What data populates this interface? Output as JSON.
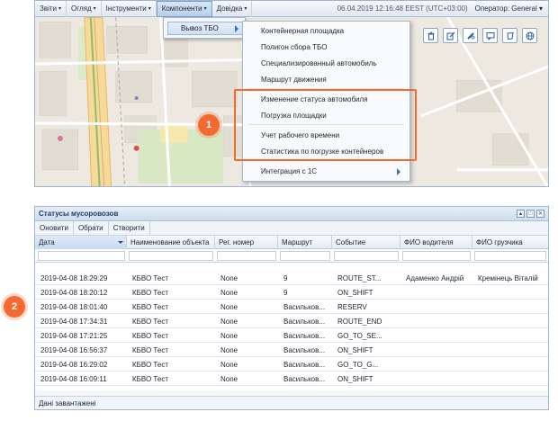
{
  "menubar": {
    "items": [
      {
        "label": "Звіти"
      },
      {
        "label": "Огляд"
      },
      {
        "label": "Інструменти"
      },
      {
        "label": "Компоненти"
      },
      {
        "label": "Довідка"
      }
    ],
    "datetime": "06.04.2019 12:16:48 EEST (UTC+03:00)",
    "operator": "Оператор: General"
  },
  "submenu_l1": {
    "label": "Вывоз ТБО"
  },
  "submenu_l2": {
    "items": [
      "Контейнерная площадка",
      "Полигон сбора ТБО",
      "Специализированный автомобиль",
      "Маршрут движения",
      "Изменение статуса автомобиля",
      "Погрузка площадки",
      "Учет рабочего времени",
      "Статистика по погрузке контейнеров",
      "Интеграция с 1С"
    ]
  },
  "map_tools": [
    "trash-icon",
    "edit-icon",
    "pencil-icon",
    "comment-icon",
    "polygon-icon",
    "globe-icon"
  ],
  "callouts": {
    "one": "1",
    "two": "2"
  },
  "grid": {
    "title": "Статусы мусоровозов",
    "toolbar": {
      "refresh": "Оновити",
      "select": "Обрати",
      "create": "Створити"
    },
    "columns": [
      "Дата",
      "Наименование объекта",
      "Рег. номер",
      "Маршрут",
      "Событие",
      "ФИО водителя",
      "ФИО грузчика"
    ],
    "rows": [
      [
        "2019-04-08 18:29:29",
        "КБВО Тест",
        "None",
        "9",
        "ROUTE_ST...",
        "Адаменко Андрій",
        "Кремінець Віталій"
      ],
      [
        "2019-04-08 18:20:12",
        "КБВО Тест",
        "None",
        "9",
        "ON_SHIFT",
        "",
        ""
      ],
      [
        "2019-04-08 18:01:40",
        "КБВО Тест",
        "None",
        "Васильков...",
        "RESERV",
        "",
        ""
      ],
      [
        "2019-04-08 17:34:31",
        "КБВО Тест",
        "None",
        "Васильков...",
        "ROUTE_END",
        "",
        ""
      ],
      [
        "2019-04-08 17:21:25",
        "КБВО Тест",
        "None",
        "Васильков...",
        "GO_TO_SE...",
        "",
        ""
      ],
      [
        "2019-04-08 16:56:37",
        "КБВО Тест",
        "None",
        "Васильков...",
        "ON_SHIFT",
        "",
        ""
      ],
      [
        "2019-04-08 16:29:02",
        "КБВО Тест",
        "None",
        "Васильков...",
        "GO_TO_G...",
        "",
        ""
      ],
      [
        "2019-04-08 16:09:11",
        "КБВО Тест",
        "None",
        "Васильков...",
        "ON_SHIFT",
        "",
        ""
      ]
    ],
    "status": "Дані завантажені"
  },
  "colors": {
    "accent": "#f26a30",
    "header_blue": "#1f3f6b"
  }
}
